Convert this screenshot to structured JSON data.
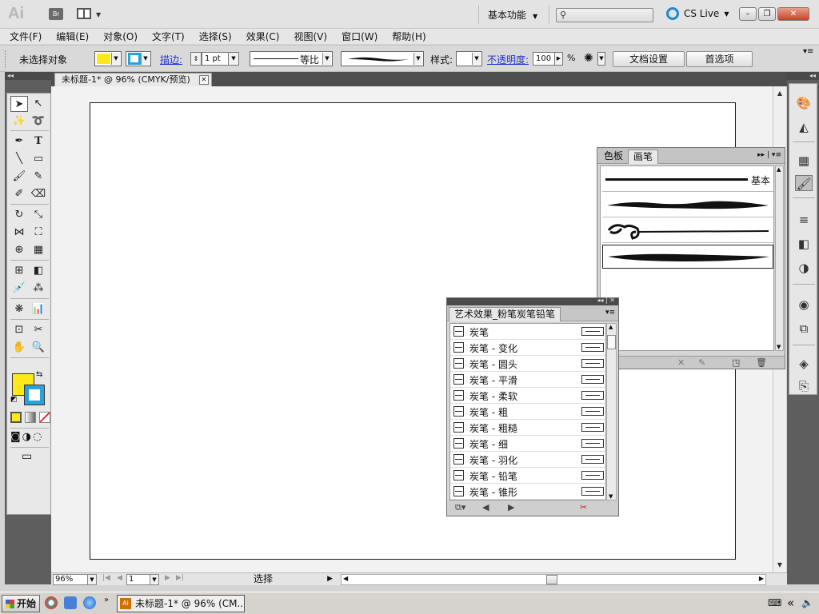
{
  "app": {
    "logo": "Ai",
    "bridge": "Br",
    "workspace": "基本功能",
    "cs_live": "CS Live",
    "win_min": "–",
    "win_restore": "❐",
    "win_close": "✕"
  },
  "menu": [
    "文件(F)",
    "编辑(E)",
    "对象(O)",
    "文字(T)",
    "选择(S)",
    "效果(C)",
    "视图(V)",
    "窗口(W)",
    "帮助(H)"
  ],
  "control": {
    "no_selection": "未选择对象",
    "fill_color": "#ffe81a",
    "stroke_color": "#29a2d8",
    "stroke_label": "描边:",
    "stroke_weight": "1 pt",
    "profile": "等比",
    "style_label": "样式:",
    "opacity_label": "不透明度:",
    "opacity_value": "100",
    "opacity_unit": "%",
    "doc_setup": "文档设置",
    "preferences": "首选项"
  },
  "document": {
    "tab_title": "未标题-1* @ 96% (CMYK/预览)"
  },
  "status": {
    "zoom": "96%",
    "page": "1",
    "tool": "选择"
  },
  "brushes_panel": {
    "tab_swatches": "色板",
    "tab_brushes": "画笔",
    "basic_label": "基本"
  },
  "art_panel": {
    "title": "艺术效果_粉笔炭笔铅笔",
    "items": [
      "炭笔",
      "炭笔 - 变化",
      "炭笔 - 圆头",
      "炭笔 - 平滑",
      "炭笔 - 柔软",
      "炭笔 - 粗",
      "炭笔 - 粗糙",
      "炭笔 - 细",
      "炭笔 - 羽化",
      "炭笔 - 铅笔",
      "炭笔 - 锥形"
    ]
  },
  "taskbar": {
    "start": "开始",
    "task_title": "未标题-1* @ 96% (CM..."
  }
}
